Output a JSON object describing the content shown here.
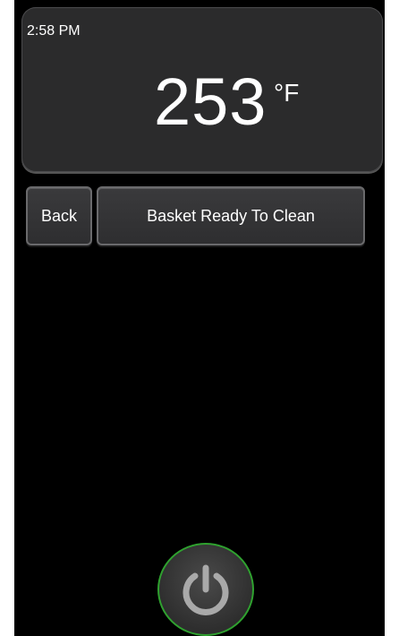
{
  "status": {
    "time": "2:58 PM"
  },
  "temperature": {
    "value": "253",
    "unit": "°F"
  },
  "actions": {
    "back_label": "Back",
    "clean_label": "Basket Ready To Clean"
  },
  "power": {
    "icon": "power-icon",
    "ring_color": "#2fa12f"
  }
}
